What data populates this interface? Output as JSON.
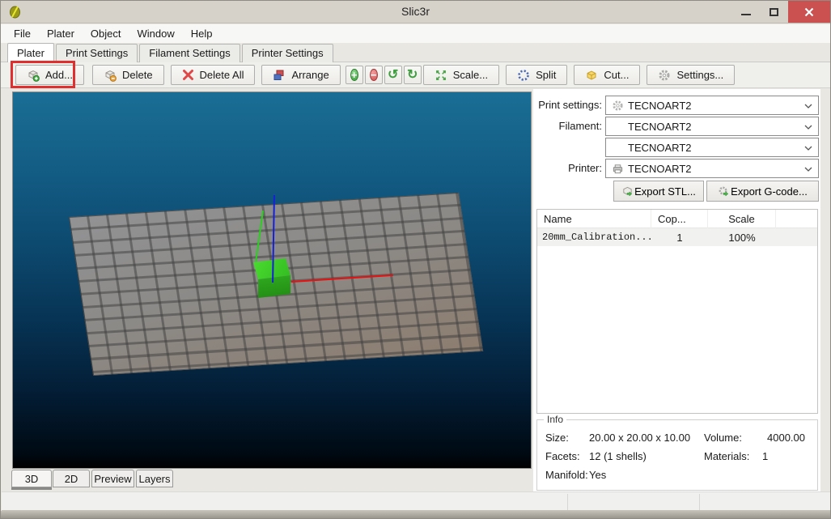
{
  "window": {
    "title": "Slic3r"
  },
  "menu": {
    "items": [
      "File",
      "Plater",
      "Object",
      "Window",
      "Help"
    ]
  },
  "tabs": {
    "items": [
      "Plater",
      "Print Settings",
      "Filament Settings",
      "Printer Settings"
    ],
    "active": "Plater"
  },
  "toolbar": {
    "add_label": "Add...",
    "delete_label": "Delete",
    "delete_all_label": "Delete All",
    "arrange_label": "Arrange",
    "scale_label": "Scale...",
    "split_label": "Split",
    "cut_label": "Cut...",
    "settings_label": "Settings...",
    "glyphs": {
      "plus": "+",
      "minus": "−",
      "rotate_ccw": "↺",
      "rotate_cw": "↻"
    }
  },
  "panel": {
    "print_settings_label": "Print settings:",
    "filament_label": "Filament:",
    "printer_label": "Printer:",
    "print_settings_value": "TECNOART2",
    "filament_value_1": "TECNOART2",
    "filament_value_2": "TECNOART2",
    "printer_value": "TECNOART2",
    "export_stl_label": "Export STL...",
    "export_gcode_label": "Export G-code..."
  },
  "object_table": {
    "columns": [
      "Name",
      "Cop...",
      "Scale"
    ],
    "rows": [
      {
        "name": "20mm_Calibration...",
        "copies": "1",
        "scale": "100%"
      }
    ]
  },
  "info": {
    "title": "Info",
    "size_label": "Size:",
    "size_value": "20.00 x 20.00 x 10.00",
    "volume_label": "Volume:",
    "volume_value": "4000.00",
    "facets_label": "Facets:",
    "facets_value": "12 (1 shells)",
    "materials_label": "Materials:",
    "materials_value": "1",
    "manifold_label": "Manifold:",
    "manifold_value": "Yes"
  },
  "view_tabs": {
    "items": [
      "3D",
      "2D",
      "Preview",
      "Layers"
    ],
    "active": "3D"
  },
  "colors": {
    "annotation_highlight": "#e12f2f",
    "close_button": "#cb5050",
    "cube_green": "#3ecb28",
    "axis_x_red": "#e81010",
    "axis_y_green": "#2ad01e",
    "axis_z_blue": "#1520d8",
    "viewport_top": "#1a6e95",
    "viewport_bottom": "#000000",
    "bed_gray": "#8c8a87"
  }
}
